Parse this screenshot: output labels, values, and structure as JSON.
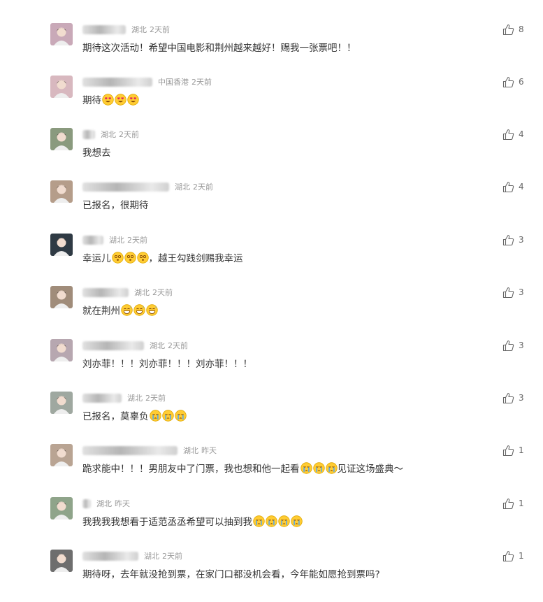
{
  "comments": [
    {
      "location": "湖北",
      "time": "2天前",
      "text": "期待这次活动！希望中国电影和荆州越来越好！赐我一张票吧！！",
      "emojis": [],
      "emoji_type": "",
      "likes": "8",
      "avatar_color": "#c9a9b8",
      "name_width": 62
    },
    {
      "location": "中国香港",
      "time": "2天前",
      "text": "期待",
      "emojis": [
        1,
        2,
        3
      ],
      "emoji_type": "heart-eyes",
      "likes": "6",
      "avatar_color": "#d8b8bf",
      "name_width": 100
    },
    {
      "location": "湖北",
      "time": "2天前",
      "text": "我想去",
      "emojis": [],
      "emoji_type": "",
      "likes": "4",
      "avatar_color": "#8a9a7e",
      "name_width": 18
    },
    {
      "location": "湖北",
      "time": "2天前",
      "text": "已报名，很期待",
      "emojis": [],
      "emoji_type": "",
      "likes": "4",
      "avatar_color": "#b59d8a",
      "name_width": 124
    },
    {
      "location": "湖北",
      "time": "2天前",
      "text": "幸运儿",
      "emojis": [
        1,
        2,
        3
      ],
      "emoji_type": "dizzy",
      "text_after": "，越王勾践剑赐我幸运",
      "likes": "3",
      "avatar_color": "#2f3a44",
      "name_width": 30
    },
    {
      "location": "湖北",
      "time": "2天前",
      "text": "就在荆州",
      "emojis": [
        1,
        2,
        3
      ],
      "emoji_type": "grin-sweat",
      "likes": "3",
      "avatar_color": "#a08c7a",
      "name_width": 66
    },
    {
      "location": "湖北",
      "time": "2天前",
      "text": "刘亦菲！！！刘亦菲！！！刘亦菲！！！",
      "emojis": [],
      "emoji_type": "",
      "likes": "3",
      "avatar_color": "#b7a7b0",
      "name_width": 88
    },
    {
      "location": "湖北",
      "time": "2天前",
      "text": "已报名，莫辜负",
      "emojis": [
        1,
        2,
        3
      ],
      "emoji_type": "cry",
      "likes": "3",
      "avatar_color": "#9fa8a0",
      "name_width": 56
    },
    {
      "location": "湖北",
      "time": "昨天",
      "text": "跪求能中！！！男朋友中了门票，我也想和他一起看",
      "emojis": [
        1,
        2,
        3
      ],
      "emoji_type": "cry",
      "text_after": "见证这场盛典～",
      "likes": "1",
      "avatar_color": "#b9a493",
      "name_width": 136
    },
    {
      "location": "湖北",
      "time": "昨天",
      "text": "我我我我想看于适范丞丞希望可以抽到我",
      "emojis": [
        1,
        2,
        3,
        4
      ],
      "emoji_type": "cry",
      "likes": "1",
      "avatar_color": "#8fa48a",
      "name_width": 12
    },
    {
      "location": "湖北",
      "time": "2天前",
      "text": "期待呀，去年就没抢到票，在家门口都没机会看，今年能如愿抢到票吗?",
      "emojis": [],
      "emoji_type": "",
      "likes": "1",
      "avatar_color": "#6e6e6e",
      "name_width": 80
    }
  ]
}
